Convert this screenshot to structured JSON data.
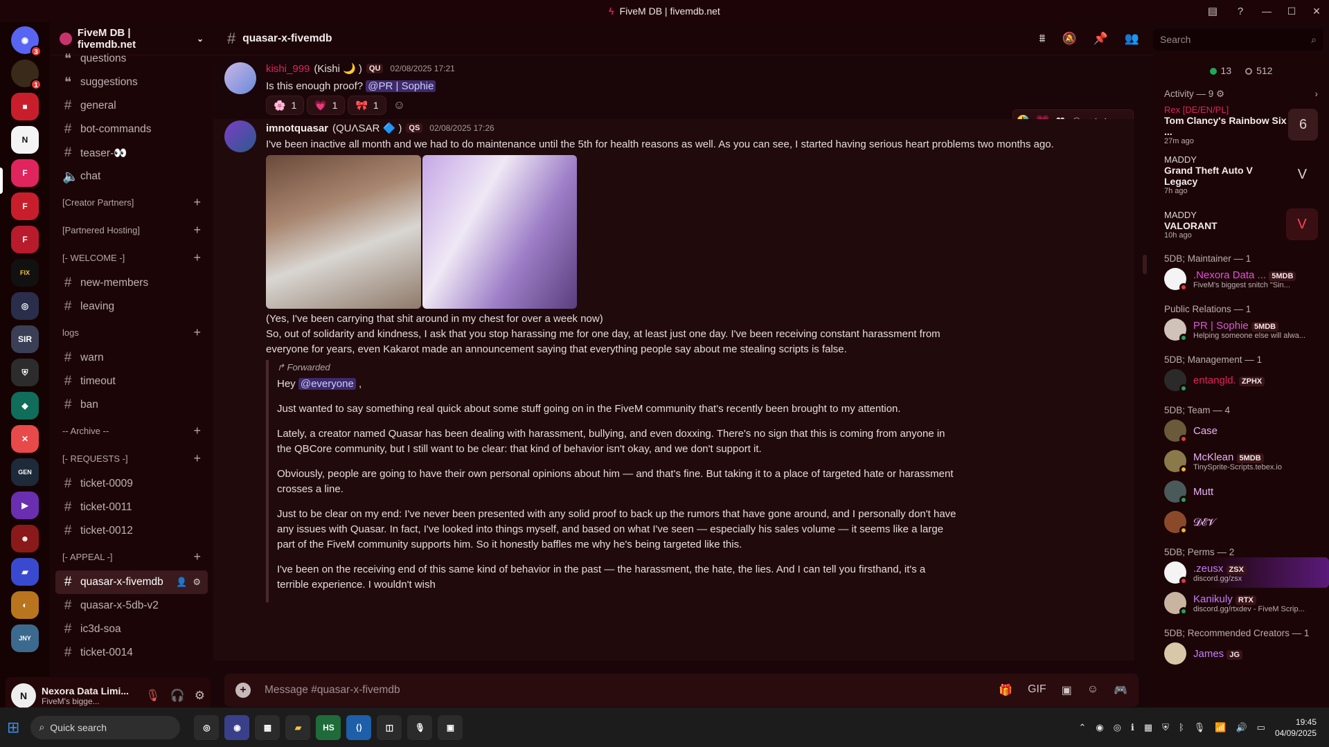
{
  "window": {
    "title": "FiveM DB | fivemdb.net"
  },
  "rail": {
    "badges": [
      "3",
      "1"
    ]
  },
  "server": {
    "name": "FiveM DB | fivemdb.net"
  },
  "channels_top": [
    {
      "name": "questions",
      "icon": "forum-icon"
    },
    {
      "name": "suggestions",
      "icon": "forum-icon"
    },
    {
      "name": "general",
      "icon": "hash-icon"
    },
    {
      "name": "bot-commands",
      "icon": "hash-icon"
    },
    {
      "name": "teaser-👀",
      "icon": "hash-icon"
    },
    {
      "name": "chat",
      "icon": "speaker-icon"
    }
  ],
  "categories": {
    "creator_partners": "[Creator Partners]",
    "partnered_hosting": "[Partnered Hosting]",
    "welcome": "[- WELCOME -]",
    "logs": "logs",
    "archive": "-- Archive --",
    "requests": "[- REQUESTS -]",
    "appeal": "[- APPEAL -]"
  },
  "welcome_channels": [
    "new-members",
    "leaving"
  ],
  "logs_channels": [
    "warn",
    "timeout",
    "ban"
  ],
  "request_channels": [
    "ticket-0009",
    "ticket-0011",
    "ticket-0012"
  ],
  "appeal_channels": [
    "quasar-x-fivemdb",
    "quasar-x-5db-v2",
    "ic3d-soa",
    "ticket-0014"
  ],
  "user_panel": {
    "name": "Nexora Data Limi...",
    "status": "FiveM's bigge..."
  },
  "chat": {
    "channel": "quasar-x-fivemdb",
    "search_placeholder": "Search",
    "composer_placeholder": "Message #quasar-x-fivemdb"
  },
  "messages": [
    {
      "username": "kishi_999",
      "display_suffix": "(Kishi 🌙 )",
      "tag": "QU",
      "timestamp": "02/08/2025 17:21",
      "text_before": "Is this enough proof?",
      "mention": "@PR | Sophie",
      "reactions": [
        {
          "emoji": "🌸",
          "count": "1"
        },
        {
          "emoji": "💗",
          "count": "1"
        },
        {
          "emoji": "🎀",
          "count": "1"
        }
      ]
    },
    {
      "username": "imnotquasar",
      "display_suffix": "(QUΛSAR 🔷 )",
      "tag": "QS",
      "timestamp": "02/08/2025 17:26",
      "line1": "I've been inactive all month and we had to do maintenance until the 5th for health reasons as well. As you can see, I started having serious heart problems two months ago.",
      "line2": "(Yes, I've been carrying that shit around in my chest for over a week now)",
      "line3": "So, out of solidarity and kindness, I ask that you stop harassing me for one day, at least just one day. I've been receiving constant harassment from everyone for years, even Kakarot made an announcement saying that everything people say about me stealing scripts is false.",
      "forwarded_label": "Forwarded",
      "fwd_hey": "Hey",
      "fwd_mention": "@everyone",
      "fwd_comma": ",",
      "fwd_p1": "Just wanted to say something real quick about some stuff going on in the FiveM community that's recently been brought to my attention.",
      "fwd_p2": "Lately, a creator named Quasar has been dealing with harassment, bullying, and even doxxing. There's no sign that this is coming from anyone in the QBCore community, but I still want to be clear: that kind of behavior isn't okay, and we don't support it.",
      "fwd_p3": "Obviously, people are going to have their own personal opinions about him — and that's fine. But taking it to a place of targeted hate or harassment crosses a line.",
      "fwd_p4": "Just to be clear on my end: I've never been presented with any solid proof to back up the rumors that have gone around, and I personally don't have any issues with Quasar. In fact, I've looked into things myself, and based on what I've seen — especially his sales volume — it seems like a large part of the FiveM community supports him. So it honestly baffles me why he's being targeted like this.",
      "fwd_p5": "I've been on the receiving end of this same kind of behavior in the past — the harassment, the hate, the lies. And I can tell you firsthand, it's a terrible experience. I wouldn't wish"
    }
  ],
  "members": {
    "online": "13",
    "total": "512",
    "activity_header": "Activity — 9",
    "activities": [
      {
        "who": "Rex [DE/EN/PL]",
        "game": "Tom Clancy's Rainbow Six ...",
        "ago": "27m ago",
        "who_color": "#e0245e"
      },
      {
        "who": "MADDY",
        "game": "Grand Theft Auto V Legacy",
        "ago": "7h ago",
        "who_color": "#f4eded"
      },
      {
        "who": "MADDY",
        "game": "VALORANT",
        "ago": "10h ago",
        "who_color": "#f4eded"
      }
    ],
    "groups": [
      {
        "title": "5DB; Maintainer — 1",
        "items": [
          {
            "name": ".Nexora Data ...",
            "tag": "5MDB",
            "sub": "FiveM's biggest snitch \"Sin...",
            "color": "#e94fd8"
          }
        ]
      },
      {
        "title": "Public Relations — 1",
        "items": [
          {
            "name": "PR | Sophie",
            "tag": "5MDB",
            "sub": "Helping someone else will alwa...",
            "color": "#d65cd6"
          }
        ]
      },
      {
        "title": "5DB; Management — 1",
        "items": [
          {
            "name": "entangld.",
            "tag": "ZPHX",
            "sub": "",
            "color": "#e0245e"
          }
        ]
      },
      {
        "title": "5DB; Team — 4",
        "items": [
          {
            "name": "Case",
            "tag": "",
            "sub": "",
            "color": "#e8b4f5"
          },
          {
            "name": "McKlean",
            "tag": "5MDB",
            "sub": "TinySprite-Scripts.tebex.io",
            "color": "#e8b4f5"
          },
          {
            "name": "Mutt",
            "tag": "",
            "sub": "",
            "color": "#e8b4f5"
          },
          {
            "name": "𝓓𝓔𝓥",
            "tag": "",
            "sub": "",
            "color": "#e8b4f5"
          }
        ]
      },
      {
        "title": "5DB; Perms — 2",
        "items": [
          {
            "name": ".zeusx",
            "tag": "ZSX",
            "sub": "discord.gg/zsx",
            "color": "#c77dff"
          },
          {
            "name": "Kanikuly",
            "tag": "RTX",
            "sub": "discord.gg/rtxdev - FiveM Scrip...",
            "color": "#c77dff"
          }
        ]
      },
      {
        "title": "5DB; Recommended Creators — 1",
        "items": [
          {
            "name": "James",
            "tag": "JG",
            "sub": "",
            "color": "#c77dff"
          }
        ]
      }
    ]
  },
  "taskbar": {
    "search": "Quick search",
    "time": "19:45",
    "date": "04/09/2025"
  }
}
